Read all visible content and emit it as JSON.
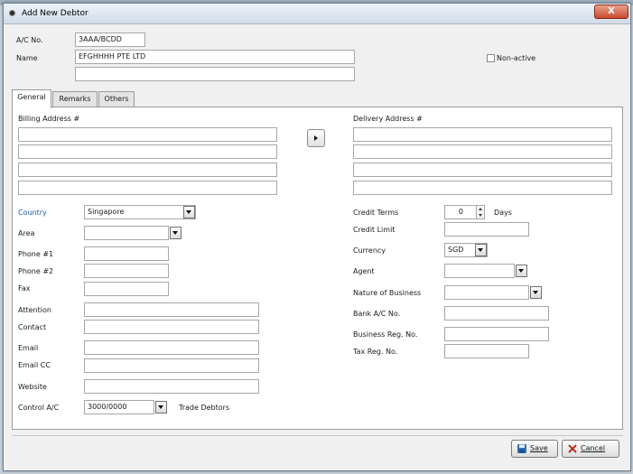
{
  "window": {
    "title": "Add New Debtor",
    "close_label": "X"
  },
  "header": {
    "ac_no_label": "A/C No.",
    "ac_no_value": "3AAA/BCDD",
    "name_label": "Name",
    "name_value": "EFGHHHH PTE LTD",
    "name2_value": "",
    "non_active_label": "Non-active"
  },
  "tabs": [
    {
      "label": "General"
    },
    {
      "label": "Remarks"
    },
    {
      "label": "Others"
    }
  ],
  "general": {
    "billing_label": "Billing Address #",
    "delivery_label": "Delivery Address #",
    "country_label": "Country",
    "country_value": "Singapore",
    "area_label": "Area",
    "area_value": "",
    "phone1_label": "Phone #1",
    "phone2_label": "Phone #2",
    "fax_label": "Fax",
    "attention_label": "Attention",
    "contact_label": "Contact",
    "email_label": "Email",
    "email_cc_label": "Email CC",
    "website_label": "Website",
    "control_ac_label": "Control A/C",
    "control_ac_value": "3000/0000",
    "control_ac_desc": "Trade Debtors",
    "credit_terms_label": "Credit Terms",
    "credit_terms_value": "0",
    "days_label": "Days",
    "credit_limit_label": "Credit Limit",
    "currency_label": "Currency",
    "currency_value": "SGD",
    "agent_label": "Agent",
    "nature_label": "Nature of Business",
    "bank_label": "Bank A/C No.",
    "business_reg_label": "Business Reg. No.",
    "tax_reg_label": "Tax Reg. No."
  },
  "footer": {
    "save_label": "Save",
    "cancel_label": "Cancel"
  },
  "colors": {
    "accent_label": "#1a5fa8",
    "close_button": "#c94a2f",
    "save_icon": "#2f6fb5",
    "cancel_icon": "#c0271b"
  },
  "icons": {
    "title": "window-icon",
    "save": "floppy-disk-icon",
    "cancel": "x-icon"
  }
}
